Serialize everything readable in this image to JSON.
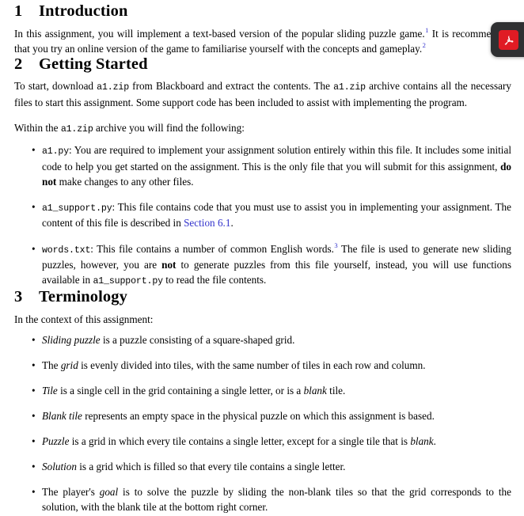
{
  "document": {
    "sections": [
      {
        "number": "1",
        "title": "Introduction",
        "intro_a": "In this assignment, you will implement a text-based version of the popular sliding puzzle game.",
        "footnote_1": "1",
        "intro_b": " It is recommended that you try an online version of the game to familiarise yourself with the concepts and gameplay.",
        "footnote_2": "2"
      },
      {
        "number": "2",
        "title": "Getting Started",
        "p1_a": "To start, download ",
        "p1_code1": "a1.zip",
        "p1_b": " from Blackboard and extract the contents. The ",
        "p1_code2": "a1.zip",
        "p1_c": " archive contains all the necessary files to start this assignment. Some support code has been included to assist with implementing the program.",
        "p2_a": "Within the ",
        "p2_code": "a1.zip",
        "p2_b": " archive you will find the following:",
        "bullets": [
          {
            "code": "a1.py",
            "text_a": ": You are required to implement your assignment solution entirely within this file. It includes some initial code to help you get started on the assignment. This is the only file that you will submit for this assignment, ",
            "bold": "do not",
            "text_b": " make changes to any other files."
          },
          {
            "code": "a1_support.py",
            "text_a": ": This file contains code that you must use to assist you in implementing your assignment. The content of this file is described in ",
            "link": "Section 6.1",
            "text_b": "."
          },
          {
            "code": "words.txt",
            "text_a": ": This file contains a number of common English words.",
            "footnote": "3",
            "text_b": " The file is used to generate new sliding puzzles, however, you are ",
            "bold": "not",
            "text_c": " to generate puzzles from this file yourself, instead, you will use functions available in ",
            "code2": "a1_support.py",
            "text_d": " to read the file contents."
          }
        ]
      },
      {
        "number": "3",
        "title": "Terminology",
        "lead": "In the context of this assignment:",
        "bullets": [
          {
            "term": "Sliding puzzle",
            "text": " is a puzzle consisting of a square-shaped grid."
          },
          {
            "prefix": "The ",
            "term": "grid",
            "text": " is evenly divided into tiles, with the same number of tiles in each row and column."
          },
          {
            "term": "Tile",
            "text": " is a single cell in the grid containing a single letter, or is a ",
            "term2": "blank",
            "text2": " tile."
          },
          {
            "term": "Blank tile",
            "text": " represents an empty space in the physical puzzle on which this assignment is based."
          },
          {
            "term": "Puzzle",
            "text": " is a grid in which every tile contains a single letter, except for a single tile that is ",
            "term2": "blank",
            "text2": "."
          },
          {
            "term": "Solution",
            "text": " is a grid which is filled so that every tile contains a single letter."
          },
          {
            "prefix": "The player's ",
            "term": "goal",
            "text": " is to solve the puzzle by sliding the non-blank tiles so that the grid corresponds to the solution, with the blank tile at the bottom right corner."
          }
        ]
      }
    ],
    "bullet_glyph": "•"
  },
  "overlay": {
    "app_label": "O",
    "icon_name": "adobe-acrobat-pdf-icon",
    "badge_color": "#e01b24",
    "background_color": "#2f3032"
  },
  "theme": {
    "link_color": "#3333cc",
    "text_color": "#000000",
    "page_background": "#ffffff"
  }
}
